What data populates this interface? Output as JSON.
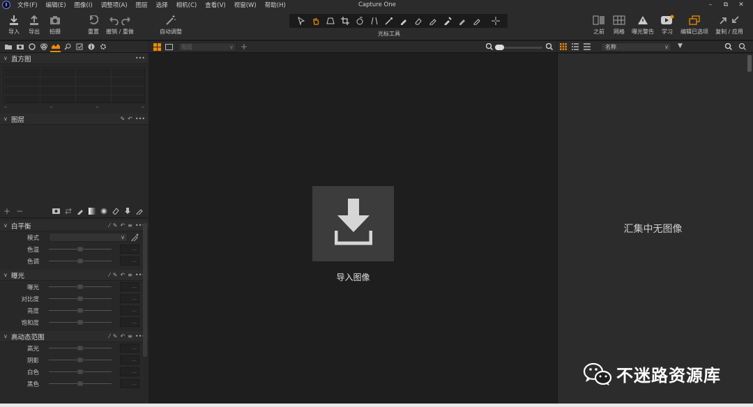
{
  "app": {
    "title": "Capture One"
  },
  "menu": [
    "文件(F)",
    "编辑(E)",
    "图像(I)",
    "调整项(A)",
    "图层",
    "选择",
    "相机(C)",
    "查看(V)",
    "视窗(W)",
    "帮助(H)"
  ],
  "window_controls": [
    "–",
    "⧉",
    "✕"
  ],
  "toolbar": {
    "import": "导入",
    "export": "导出",
    "capture": "拍摄",
    "reset": "重置",
    "undo_redo": "撤销 / 重做",
    "auto_adjust": "自动调整",
    "cursor_tools": "光标工具",
    "before": "之前",
    "grid": "网格",
    "exposure_warning": "曝光警告",
    "learn": "学习",
    "edit_selected": "编辑已选项",
    "copy_apply": "复制 / 应用"
  },
  "left": {
    "histogram": {
      "title": "直方图",
      "values": [
        "–",
        "–",
        "–",
        "–"
      ]
    },
    "layers": {
      "title": "图层"
    },
    "white_balance": {
      "title": "白平衡",
      "mode_label": "模式",
      "temperature_label": "色温",
      "tint_label": "色调"
    },
    "exposure": {
      "title": "曝光",
      "exposure_label": "曝光",
      "contrast_label": "对比度",
      "brightness_label": "亮度",
      "saturation_label": "饱和度"
    },
    "hdr": {
      "title": "高动态范围",
      "highlight_label": "高光",
      "shadow_label": "阴影",
      "white_label": "白色",
      "black_label": "黑色"
    }
  },
  "viewer": {
    "layer_select": "图层",
    "import_label": "导入图像"
  },
  "browser": {
    "sort_label": "名称",
    "empty_message": "汇集中无图像"
  },
  "watermark": {
    "text": "不迷路资源库"
  },
  "colors": {
    "accent": "#f08a00",
    "panel": "#282828",
    "viewer": "#1e1e1e",
    "import_box": "#3c3c3c"
  }
}
